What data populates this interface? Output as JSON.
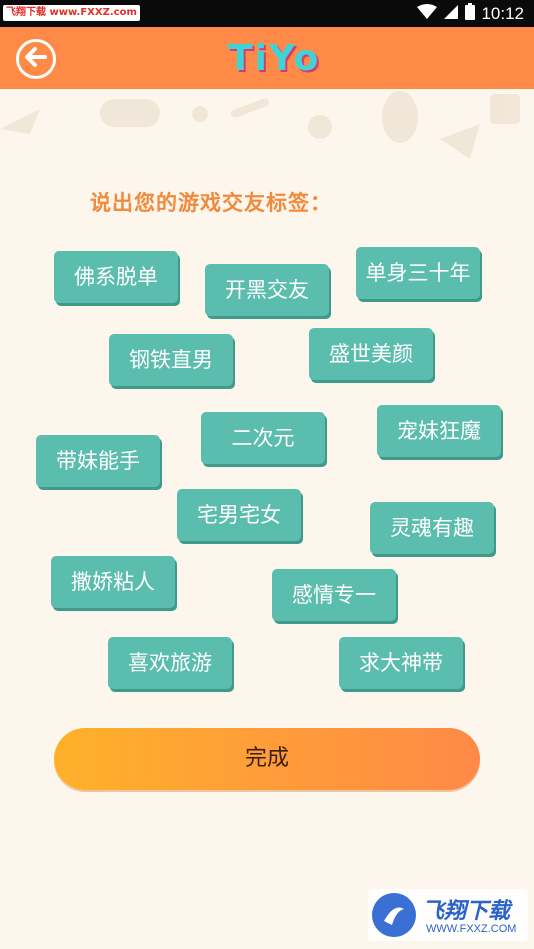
{
  "status_bar": {
    "watermark": "飞翔下载 www.FXXZ.com",
    "time": "10:12"
  },
  "header": {
    "logo": "TiYo",
    "accent": "#ff8a47"
  },
  "prompt": "说出您的游戏交友标签：",
  "tags": [
    "佛系脱单",
    "开黑交友",
    "单身三十年",
    "钢铁直男",
    "盛世美颜",
    "二次元",
    "宠妹狂魔",
    "带妹能手",
    "宅男宅女",
    "灵魂有趣",
    "撒娇粘人",
    "感情专一",
    "喜欢旅游",
    "求大神带"
  ],
  "done_button": "完成",
  "watermark_bottom": {
    "title": "飞翔下载",
    "url": "WWW.FXXZ.COM"
  },
  "colors": {
    "tag_bg": "#5bbdae",
    "prompt": "#f08a3c",
    "background": "#fdf6ec"
  }
}
